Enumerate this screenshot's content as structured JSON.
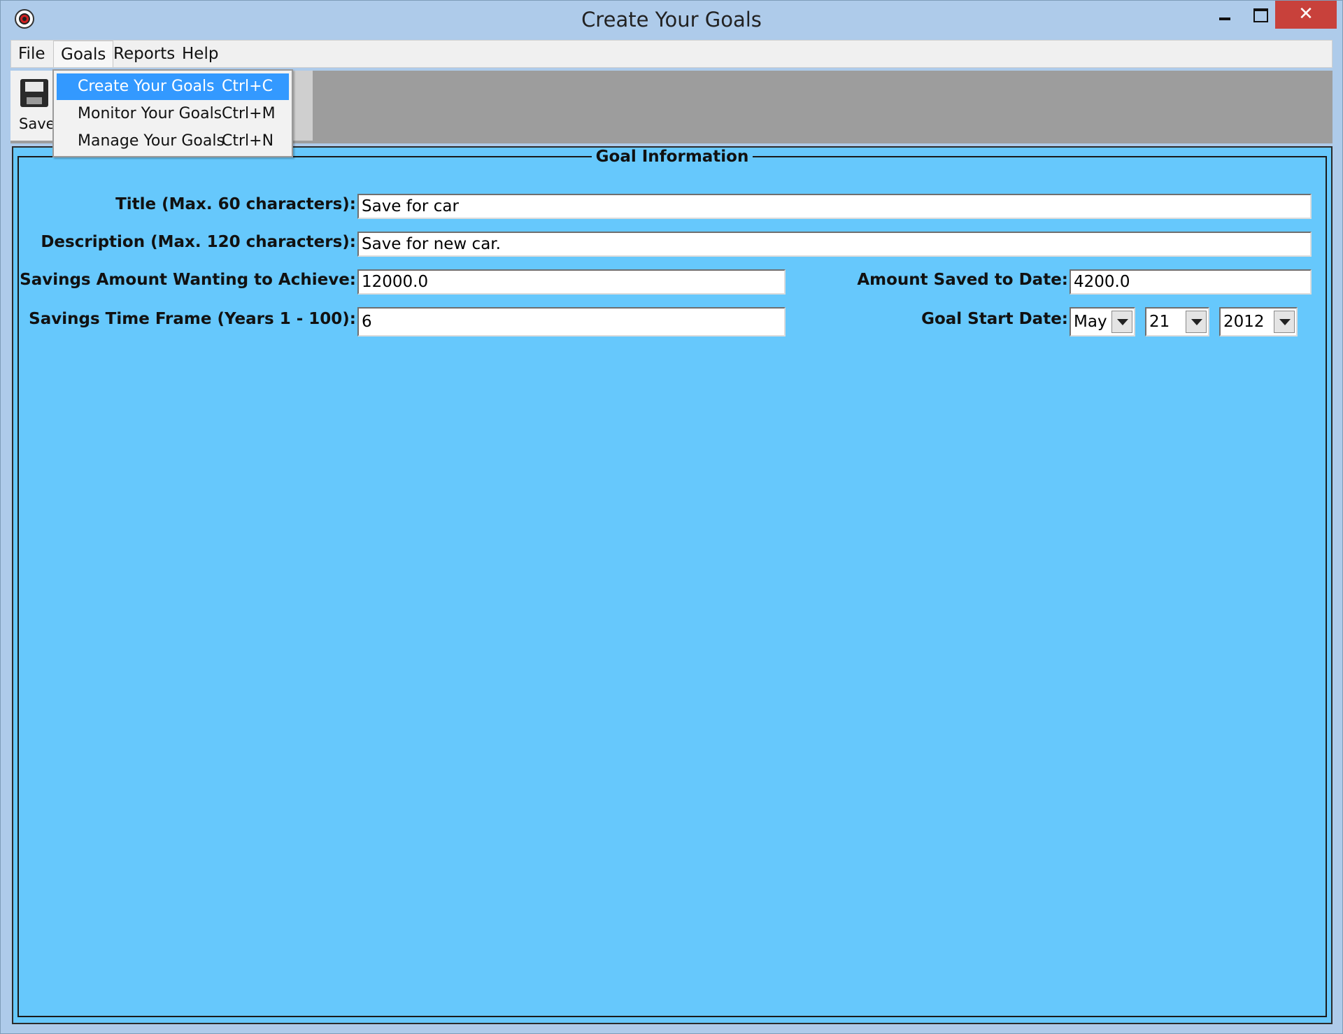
{
  "window": {
    "title": "Create Your Goals"
  },
  "menubar": {
    "items": [
      "File",
      "Goals",
      "Reports",
      "Help"
    ]
  },
  "goals_menu": {
    "items": [
      {
        "label": "Create Your Goals",
        "shortcut": "Ctrl+C",
        "selected": true
      },
      {
        "label": "Monitor Your Goals",
        "shortcut": "Ctrl+M",
        "selected": false
      },
      {
        "label": "Manage Your Goals",
        "shortcut": "Ctrl+N",
        "selected": false
      }
    ]
  },
  "toolbar": {
    "save_label": "Save",
    "save_icon": "floppy-disk-icon"
  },
  "form": {
    "group_title": "Goal Information",
    "title_label": "Title (Max. 60 characters):",
    "title_value": "Save for car",
    "description_label": "Description (Max. 120 characters):",
    "description_value": "Save for new car.",
    "amount_label": "Savings Amount Wanting to Achieve:",
    "amount_value": "12000.0",
    "saved_label": "Amount Saved to Date:",
    "saved_value": "4200.0",
    "timeframe_label": "Savings Time Frame (Years 1 - 100):",
    "timeframe_value": "6",
    "start_date_label": "Goal Start Date:",
    "start_month": "May",
    "start_day": "21",
    "start_year": "2012"
  },
  "colors": {
    "panel_bg": "#66c8fc",
    "menu_highlight": "#3399ff",
    "close_button": "#c8413b"
  }
}
